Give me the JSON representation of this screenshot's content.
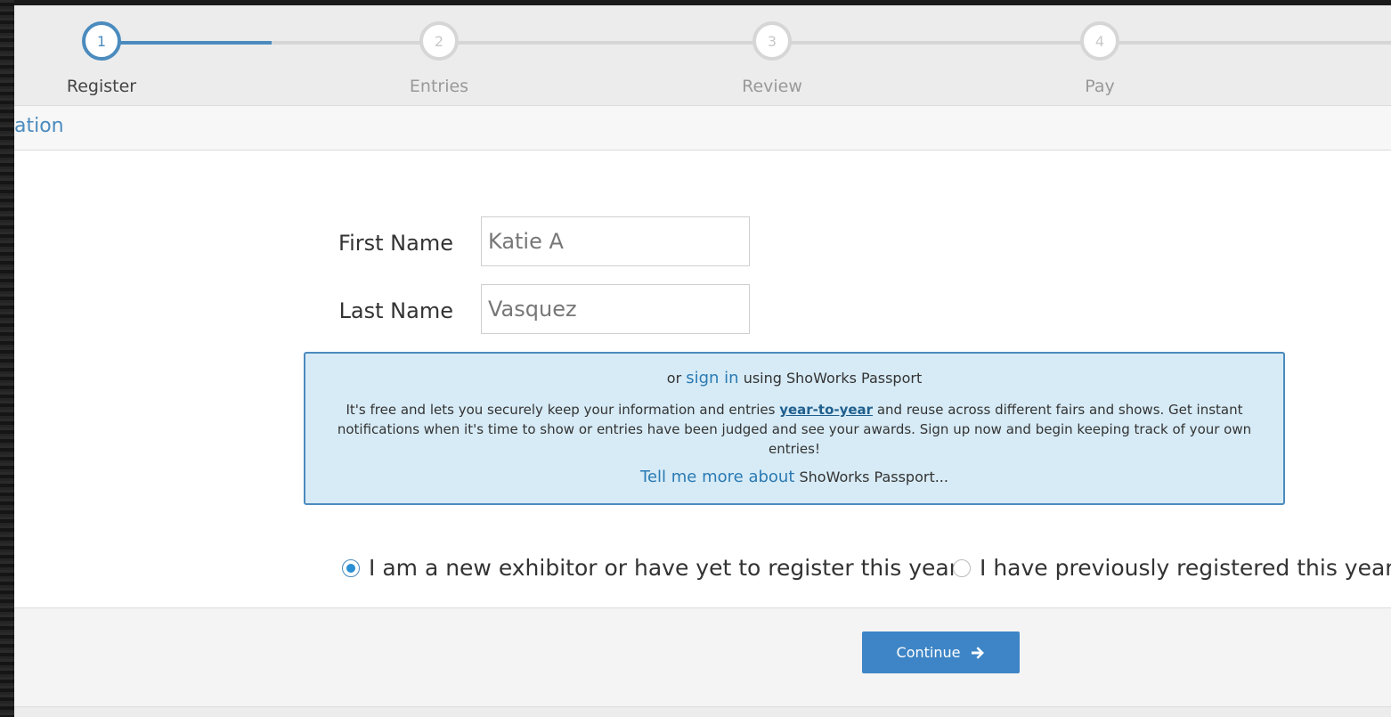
{
  "stepper": {
    "steps": [
      {
        "number": "1",
        "label": "Register"
      },
      {
        "number": "2",
        "label": "Entries"
      },
      {
        "number": "3",
        "label": "Review"
      },
      {
        "number": "4",
        "label": "Pay"
      }
    ],
    "active_step": 1
  },
  "section": {
    "title": "ation"
  },
  "form": {
    "first_name_label": "First Name",
    "first_name_value": "Katie A",
    "last_name_label": "Last Name",
    "last_name_value": "Vasquez"
  },
  "passport": {
    "line1_prefix": "or",
    "sign_in_link": "sign in",
    "line1_suffix": "using ShoWorks Passport",
    "desc_prefix": "It's free and lets you securely keep your information and entries",
    "desc_link": "year-to-year",
    "desc_suffix": "and reuse across different fairs and shows. Get instant notifications when it's time to show or entries have been judged and see your awards. Sign up now and begin keeping track of your own entries!",
    "more_link": "Tell me more about",
    "more_suffix": "ShoWorks Passport..."
  },
  "registration_type": {
    "options": [
      {
        "label": "I am a new exhibitor or have yet to register this year",
        "checked": true
      },
      {
        "label": "I have previously registered this year",
        "checked": false
      }
    ]
  },
  "footer": {
    "continue_label": "Continue"
  },
  "colors": {
    "accent": "#4b8bbe",
    "button": "#3d85c6",
    "info_bg": "#d7ebf6"
  },
  "icons": {
    "continue": "arrow-right-icon"
  }
}
